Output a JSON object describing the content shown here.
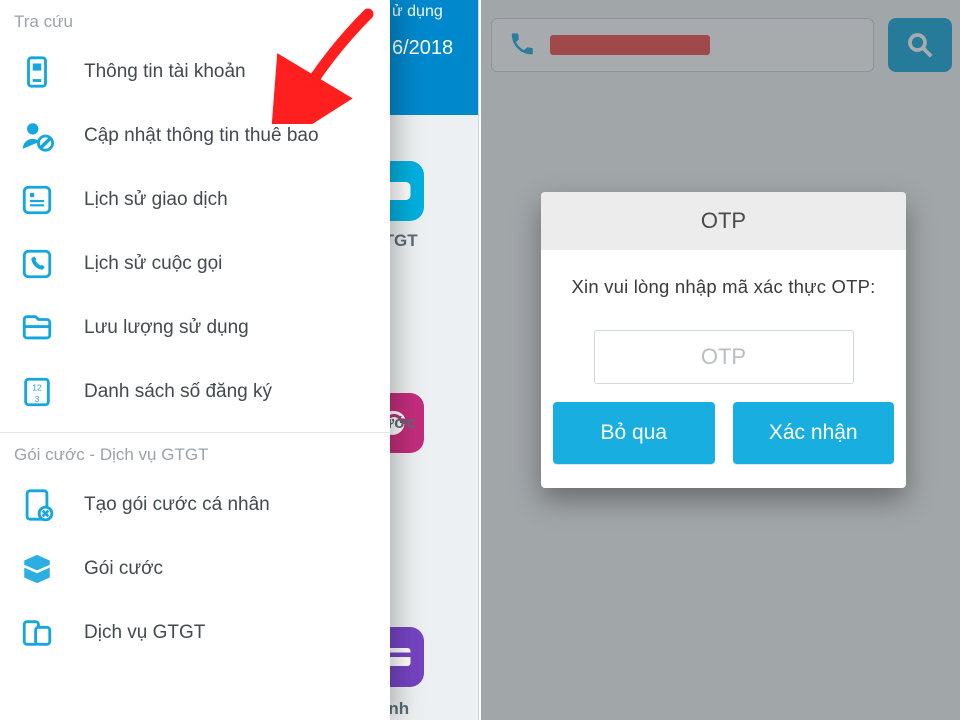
{
  "colors": {
    "accent_blue": "#17a8dc",
    "header_blue": "#0088cc",
    "tile_blue": "#00b0e0",
    "tile_magenta": "#c32d7b",
    "tile_purple": "#7444c2",
    "arrow_red": "#ff1f1f"
  },
  "left": {
    "header_line1_fragment": "ử dụng",
    "header_line2_fragment": "6/2018",
    "tile1_label_fragment": "GTGT",
    "tile2_label_fragment": "cước",
    "tile3_label_fragment": "anh"
  },
  "drawer": {
    "section1_title": "Tra cứu",
    "items1": [
      {
        "icon": "account-phone-icon",
        "label": "Thông tin tài khoản"
      },
      {
        "icon": "user-update-icon",
        "label": "Cập nhật thông tin thuê bao"
      },
      {
        "icon": "transaction-history-icon",
        "label": "Lịch sử giao dịch"
      },
      {
        "icon": "call-history-icon",
        "label": "Lịch sử cuộc gọi"
      },
      {
        "icon": "data-usage-icon",
        "label": "Lưu lượng sử dụng"
      },
      {
        "icon": "sim-list-icon",
        "label": "Danh sách số đăng ký"
      }
    ],
    "section2_title": "Gói cước - Dịch vụ GTGT",
    "items2": [
      {
        "icon": "create-plan-icon",
        "label": "Tạo gói cước cá nhân"
      },
      {
        "icon": "plan-box-icon",
        "label": "Gói cước"
      },
      {
        "icon": "vas-service-icon",
        "label": "Dịch vụ GTGT"
      }
    ]
  },
  "right": {
    "search_placeholder_redacted": true
  },
  "otp": {
    "title": "OTP",
    "message": "Xin vui lòng nhập mã xác thực OTP:",
    "input_placeholder": "OTP",
    "skip_label": "Bỏ qua",
    "confirm_label": "Xác nhận"
  }
}
